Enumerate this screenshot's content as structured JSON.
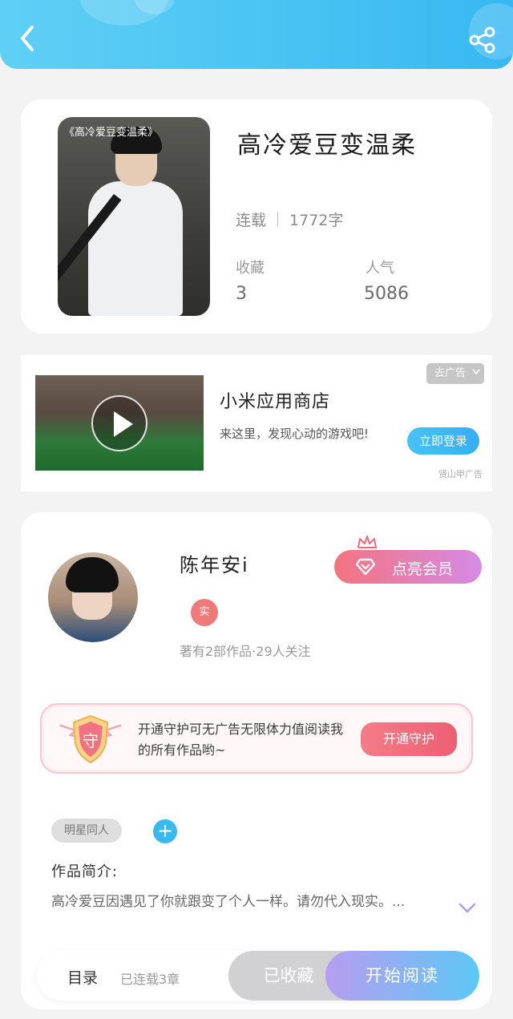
{
  "header": {
    "back_icon": "back-arrow-icon",
    "share_icon": "share-icon",
    "color": "#38b8f2"
  },
  "book": {
    "cover_title": "《高冷爱豆变温柔》",
    "title": "高冷爱豆变温柔",
    "status": "连载",
    "word_count": "1772字",
    "favorites_label": "收藏",
    "favorites_value": "3",
    "popularity_label": "人气",
    "popularity_value": "5086"
  },
  "ad": {
    "close_label": "去广告",
    "title": "小米应用商店",
    "description": "来这里，发现心动的游戏吧!",
    "cta_label": "立即登录",
    "source": "贤山甲广告"
  },
  "author": {
    "name": "陈年安i",
    "verified_badge": "实",
    "meta": "著有2部作品·29人关注",
    "vip_label": "点亮会员",
    "vip_gradient": [
      "#f3737f",
      "#d58be6"
    ]
  },
  "guard": {
    "icon_char": "守",
    "text": "开通守护可无广告无限体力值阅读我的所有作品哟~",
    "button_label": "开通守护"
  },
  "intro": {
    "tag": "明星同人",
    "add_icon": "+",
    "label": "作品简介:",
    "text": "高冷爱豆因遇见了你就跟变了个人一样。请勿代入现实。..."
  },
  "bottom_bar": {
    "toc_label": "目录",
    "chapters_label": "已连载3章",
    "collected_label": "已收藏",
    "read_label": "开始阅读"
  }
}
